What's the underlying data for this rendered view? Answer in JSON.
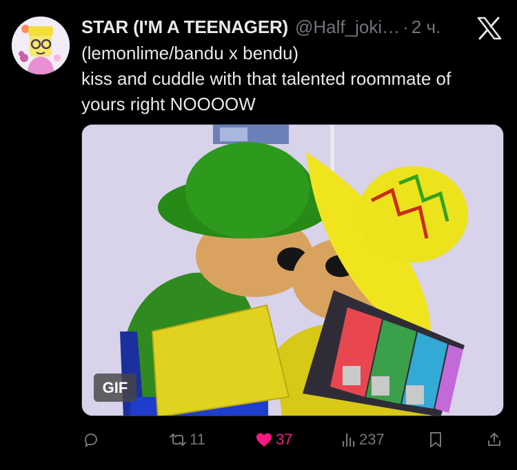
{
  "tweet": {
    "author_name": "STAR (I'M A TEENAGER)",
    "handle": "@Half_joki…",
    "separator": "·",
    "time": "2 ч.",
    "text_lines": [
      "(lemonlime/bandu x bendu)",
      "kiss and cuddle with that talented roommate of",
      "yours right NOOOOW"
    ]
  },
  "media": {
    "badge": "GIF"
  },
  "actions": {
    "reply": {
      "icon": "reply-icon",
      "count": ""
    },
    "repost": {
      "icon": "repost-icon",
      "count": "11"
    },
    "like": {
      "icon": "heart-icon",
      "count": "37",
      "active": true,
      "color": "#f91880"
    },
    "views": {
      "icon": "views-icon",
      "count": "237"
    },
    "bookmark": {
      "icon": "bookmark-icon"
    },
    "share": {
      "icon": "share-icon"
    }
  },
  "colors": {
    "background": "#000000",
    "primary_text": "#e7e9ea",
    "secondary_text": "#71767b",
    "like": "#f91880"
  }
}
